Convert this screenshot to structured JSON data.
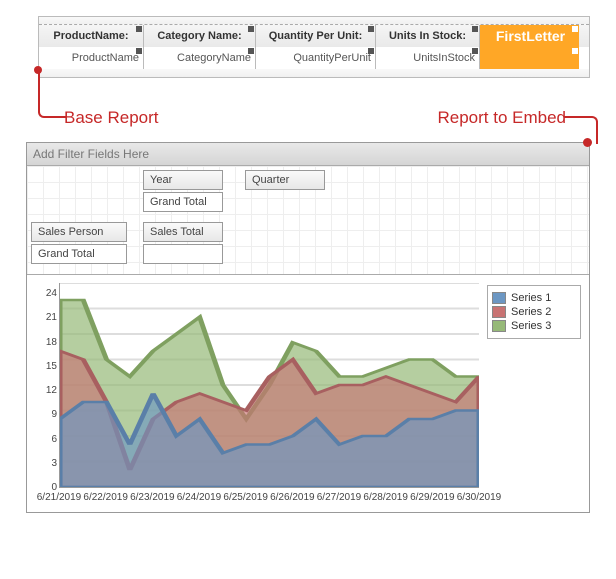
{
  "base_report": {
    "columns": [
      {
        "header": "ProductName:",
        "field": "ProductName"
      },
      {
        "header": "Category Name:",
        "field": "CategoryName"
      },
      {
        "header": "Quantity Per Unit:",
        "field": "QuantityPerUnit"
      },
      {
        "header": "Units In Stock:",
        "field": "UnitsInStock"
      }
    ],
    "embed_caption": "FirstLetter"
  },
  "callouts": {
    "base": "Base Report",
    "embed": "Report to Embed"
  },
  "pivot": {
    "filter_hint": "Add Filter Fields Here",
    "col_fields": [
      "Year",
      "Quarter"
    ],
    "col_total": "Grand Total",
    "row_fields": [
      "Sales Person"
    ],
    "row_total": "Grand Total",
    "data_field": "Sales Total"
  },
  "chart_data": {
    "type": "area",
    "x": [
      "6/21/2019",
      "6/22/2019",
      "6/23/2019",
      "6/24/2019",
      "6/25/2019",
      "6/26/2019",
      "6/27/2019",
      "6/28/2019",
      "6/29/2019",
      "6/30/2019"
    ],
    "ylim": [
      0,
      24
    ],
    "yticks": [
      0,
      3,
      6,
      9,
      12,
      15,
      18,
      21,
      24
    ],
    "series": [
      {
        "name": "Series 1",
        "color": "#6c97c3",
        "values": [
          8,
          10,
          10,
          5,
          11,
          6,
          8,
          4,
          5,
          5,
          6,
          8,
          5,
          6,
          6,
          8,
          8,
          9,
          9
        ]
      },
      {
        "name": "Series 2",
        "color": "#c87373",
        "values": [
          16,
          15,
          10,
          2,
          8,
          10,
          11,
          10,
          9,
          13,
          15,
          11,
          12,
          12,
          13,
          12,
          11,
          10,
          13
        ]
      },
      {
        "name": "Series 3",
        "color": "#96b978",
        "values": [
          22,
          22,
          15,
          13,
          16,
          18,
          20,
          12,
          8,
          12,
          17,
          16,
          13,
          13,
          14,
          15,
          15,
          13,
          13
        ]
      }
    ],
    "legend_position": "right"
  }
}
